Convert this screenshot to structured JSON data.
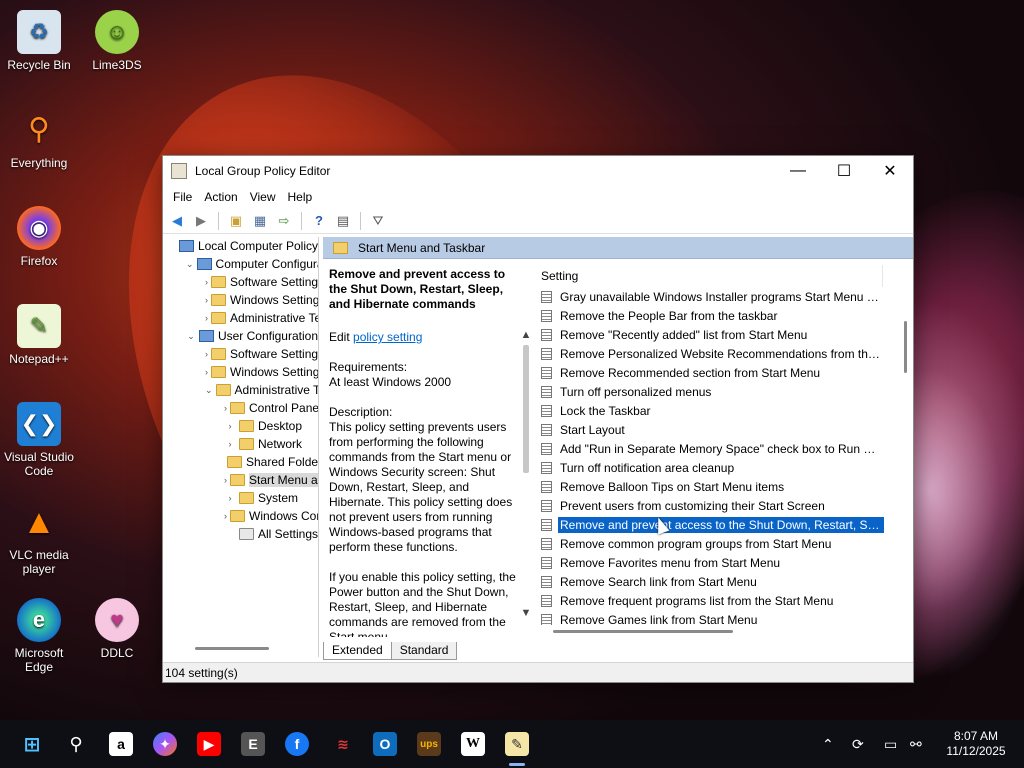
{
  "desktop": {
    "icons": [
      {
        "label": "Recycle Bin",
        "icon": "recycle-bin-icon"
      },
      {
        "label": "Lime3DS",
        "icon": "lime3ds-icon"
      },
      {
        "label": "Everything",
        "icon": "everything-search-icon"
      },
      {
        "label": "Firefox",
        "icon": "firefox-icon"
      },
      {
        "label": "Notepad++",
        "icon": "notepadpp-icon"
      },
      {
        "label": "Visual Studio Code",
        "icon": "vscode-icon"
      },
      {
        "label": "VLC media player",
        "icon": "vlc-icon"
      },
      {
        "label": "Microsoft Edge",
        "icon": "edge-icon"
      },
      {
        "label": "DDLC",
        "icon": "ddlc-icon"
      }
    ]
  },
  "window": {
    "title": "Local Group Policy Editor",
    "menu": [
      "File",
      "Action",
      "View",
      "Help"
    ],
    "tree": [
      {
        "label": "Local Computer Policy",
        "indent": 0,
        "arrow": "",
        "icon": "pc"
      },
      {
        "label": "Computer Configura",
        "indent": 1,
        "arrow": "v",
        "icon": "pc"
      },
      {
        "label": "Software Settings",
        "indent": 2,
        "arrow": ">",
        "icon": "folder"
      },
      {
        "label": "Windows Setting",
        "indent": 2,
        "arrow": ">",
        "icon": "folder"
      },
      {
        "label": "Administrative Te",
        "indent": 2,
        "arrow": ">",
        "icon": "folder"
      },
      {
        "label": "User Configuration",
        "indent": 1,
        "arrow": "v",
        "icon": "pc"
      },
      {
        "label": "Software Settings",
        "indent": 2,
        "arrow": ">",
        "icon": "folder"
      },
      {
        "label": "Windows Setting",
        "indent": 2,
        "arrow": ">",
        "icon": "folder"
      },
      {
        "label": "Administrative Te",
        "indent": 2,
        "arrow": "v",
        "icon": "folder"
      },
      {
        "label": "Control Panel",
        "indent": 3,
        "arrow": ">",
        "icon": "folder"
      },
      {
        "label": "Desktop",
        "indent": 3,
        "arrow": ">",
        "icon": "folder"
      },
      {
        "label": "Network",
        "indent": 3,
        "arrow": ">",
        "icon": "folder"
      },
      {
        "label": "Shared Folder",
        "indent": 3,
        "arrow": "",
        "icon": "folder"
      },
      {
        "label": "Start Menu ar",
        "indent": 3,
        "arrow": ">",
        "icon": "folder",
        "selected": true
      },
      {
        "label": "System",
        "indent": 3,
        "arrow": ">",
        "icon": "folder"
      },
      {
        "label": "Windows Cor",
        "indent": 3,
        "arrow": ">",
        "icon": "folder"
      },
      {
        "label": "All Settings",
        "indent": 3,
        "arrow": "",
        "icon": "settings"
      }
    ],
    "header": "Start Menu and Taskbar",
    "description": {
      "title": "Remove and prevent access to the Shut Down, Restart, Sleep, and Hibernate commands",
      "edit_prefix": "Edit",
      "edit_link": "policy setting",
      "requirements_label": "Requirements:",
      "requirements": "At least Windows 2000",
      "description_label": "Description:",
      "description": "This policy setting prevents users from performing the following commands from the Start menu or Windows Security screen: Shut Down, Restart, Sleep, and Hibernate. This policy setting does not prevent users from running Windows-based programs that perform these functions.",
      "more": "If you enable this policy setting, the Power button and the Shut Down, Restart, Sleep, and Hibernate commands are removed from the Start menu."
    },
    "list_header": "Setting",
    "settings": [
      "Gray unavailable Windows Installer programs Start Menu sh...",
      "Remove the People Bar from the taskbar",
      "Remove \"Recently added\" list from Start Menu",
      "Remove Personalized Website Recommendations from the ...",
      "Remove Recommended section from Start Menu",
      "Turn off personalized menus",
      "Lock the Taskbar",
      "Start Layout",
      "Add \"Run in Separate Memory Space\" check box to Run dial...",
      "Turn off notification area cleanup",
      "Remove Balloon Tips on Start Menu items",
      "Prevent users from customizing their Start Screen",
      "Remove and prevent access to the Shut Down, Restart, Sleep...",
      "Remove common program groups from Start Menu",
      "Remove Favorites menu from Start Menu",
      "Remove Search link from Start Menu",
      "Remove frequent programs list from the Start Menu",
      "Remove Games link from Start Menu"
    ],
    "selected_index": 12,
    "tabs": [
      "Extended",
      "Standard"
    ],
    "status": "104 setting(s)"
  },
  "taskbar": {
    "apps": [
      "start-icon",
      "search-icon",
      "amazon-icon",
      "copilot-icon",
      "youtube-icon",
      "epic-games-icon",
      "facebook-icon",
      "app-red-icon",
      "outlook-icon",
      "ups-icon",
      "wikipedia-icon",
      "notepad-icon"
    ],
    "time": "8:07 AM",
    "date": "11/12/2025"
  },
  "colors": {
    "selection": "#0a64c8",
    "header_bar": "#b8cbe4",
    "taskbar": "#0e0f14"
  }
}
